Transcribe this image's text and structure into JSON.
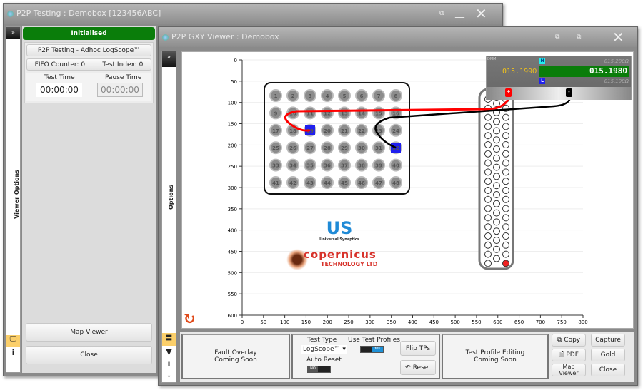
{
  "window1": {
    "title": "P2P Testing : Demobox  [123456ABC]",
    "status": "Initialised",
    "status_color": "#0a7d0a",
    "mode_label": "P2P Testing - Adhoc LogScope™",
    "fifo_label": "FIFO Counter:",
    "fifo_value": "0",
    "index_label": "Test Index:",
    "index_value": "0",
    "test_time_label": "Test Time",
    "test_time": "00:00:00",
    "pause_time_label": "Pause Time",
    "pause_time": "00:00:00",
    "side_label": "Viewer Options",
    "map_viewer": "Map Viewer",
    "close": "Close"
  },
  "window2": {
    "title": "P2P GXY Viewer : Demobox",
    "side_label": "Options"
  },
  "plot": {
    "x_ticks": [
      0,
      50,
      100,
      150,
      200,
      250,
      300,
      350,
      400,
      450,
      500,
      550,
      600,
      650,
      700,
      750,
      800
    ],
    "y_ticks": [
      0,
      50,
      100,
      150,
      200,
      250,
      300,
      350,
      400,
      450,
      500,
      550,
      600
    ],
    "pins": [
      1,
      2,
      3,
      4,
      5,
      6,
      7,
      8,
      9,
      10,
      11,
      12,
      13,
      14,
      15,
      16,
      17,
      18,
      19,
      20,
      21,
      22,
      23,
      24,
      25,
      26,
      27,
      28,
      29,
      30,
      31,
      32,
      33,
      34,
      35,
      36,
      37,
      38,
      39,
      40,
      41,
      42,
      43,
      44,
      45,
      46,
      47,
      48
    ],
    "active_pins": [
      19,
      32
    ],
    "pin_color": "#8c8c8c",
    "active_color": "#2020ee",
    "logo_us": "US",
    "logo_us_sub": "Universal Synaptics",
    "logo_cop": "Copernicus",
    "logo_cop_sub": "Technology Ltd"
  },
  "dmm": {
    "label": "DMM",
    "high_tag": "H",
    "low_tag": "L",
    "high": "015.200Ω",
    "low": "015.198Ω",
    "value_left": "015.199Ω",
    "value_main": "015.198Ω",
    "plus": "+",
    "minus": "-"
  },
  "bottom": {
    "fault_overlay": "Fault Overlay\nComing Soon",
    "test_type_label": "Test Type",
    "test_type": "LogScope™",
    "use_profiles_label": "Use Test Profiles",
    "use_profiles": "Yes",
    "auto_reset_label": "Auto Reset",
    "auto_reset": "NO",
    "flip": "Flip TPs",
    "reset": "Reset",
    "profile_editing": "Test Profile Editing\nComing Soon",
    "copy": "Copy",
    "capture": "Capture",
    "pdf": "PDF",
    "gold": "Gold",
    "map_viewer": "Map Viewer",
    "close": "Close"
  }
}
